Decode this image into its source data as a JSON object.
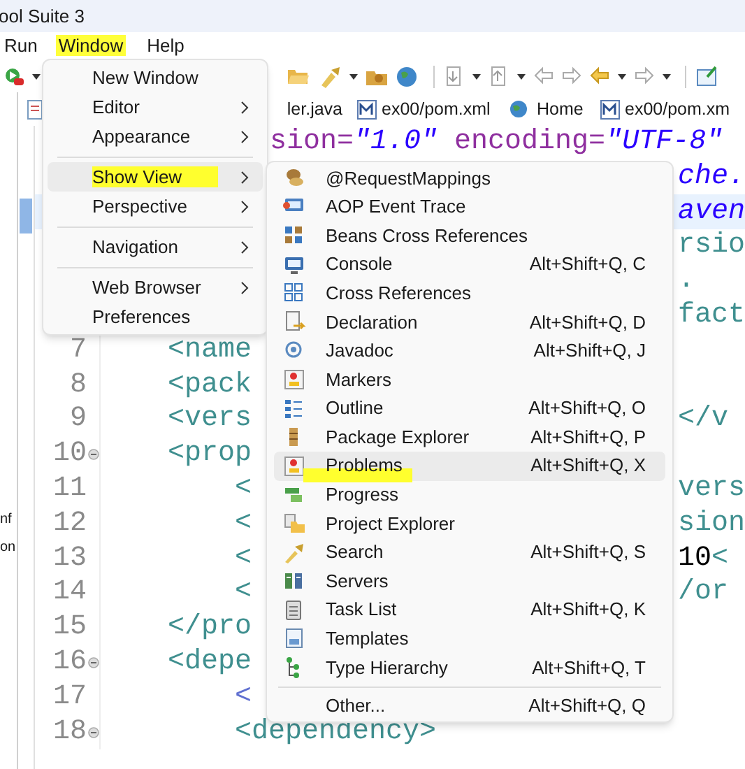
{
  "window": {
    "title": "ool Suite 3"
  },
  "menu_bar": [
    {
      "label": "Run",
      "highlighted": false
    },
    {
      "label": "Window",
      "highlighted": true
    },
    {
      "label": "Help",
      "highlighted": false
    }
  ],
  "editor_tabs": [
    {
      "label": "ler.java"
    },
    {
      "label": "ex00/pom.xml"
    },
    {
      "label": "Home"
    },
    {
      "label": "ex00/pom.xm"
    }
  ],
  "side_panel": {
    "texts": [
      "nf",
      "on"
    ]
  },
  "code_lines": [
    {
      "current": false,
      "right": {
        "kind": "near",
        "segments": [
          {
            "kind": "attr",
            "text": "sion="
          },
          {
            "kind": "string",
            "text": "\"1.0\""
          },
          {
            "kind": "attr",
            "text": " encoding="
          },
          {
            "kind": "string",
            "text": "\"UTF-8\""
          }
        ]
      }
    },
    {
      "current": false,
      "right": {
        "kind": "far",
        "segments": [
          {
            "kind": "string",
            "text": "che."
          }
        ]
      }
    },
    {
      "current": true,
      "right": {
        "kind": "far",
        "segments": [
          {
            "kind": "string",
            "text": "aven"
          }
        ]
      }
    },
    {
      "current": false,
      "right": {
        "kind": "far",
        "segments": [
          {
            "kind": "tag",
            "text": "rsio"
          }
        ]
      }
    },
    {
      "current": false,
      "right": {
        "kind": "far",
        "segments": [
          {
            "kind": "tag",
            "text": "."
          }
        ]
      }
    },
    {
      "current": false,
      "right": {
        "kind": "far",
        "segments": [
          {
            "kind": "tag",
            "text": "fact"
          }
        ]
      }
    },
    {
      "number": "7",
      "fold": false,
      "current": false,
      "left": [
        {
          "kind": "tag",
          "text": "<name"
        }
      ]
    },
    {
      "number": "8",
      "fold": false,
      "current": false,
      "left": [
        {
          "kind": "tag",
          "text": "<pack"
        }
      ]
    },
    {
      "number": "9",
      "fold": false,
      "current": false,
      "left": [
        {
          "kind": "tag",
          "text": "<vers"
        }
      ],
      "right": {
        "kind": "far",
        "segments": [
          {
            "kind": "tag",
            "text": "</v"
          }
        ]
      }
    },
    {
      "number": "10",
      "fold": true,
      "current": false,
      "left": [
        {
          "kind": "tag",
          "text": "<prop"
        }
      ],
      "children": [
        {
          "number": "11",
          "fold": false,
          "current": false,
          "left": [
            {
              "kind": "tag",
              "text": "<"
            }
          ],
          "right": {
            "kind": "far",
            "segments": [
              {
                "kind": "tag",
                "text": "vers"
              }
            ]
          }
        },
        {
          "number": "12",
          "fold": false,
          "current": false,
          "left": [
            {
              "kind": "tag",
              "text": "<"
            }
          ],
          "right": {
            "kind": "far",
            "segments": [
              {
                "kind": "tag",
                "text": "sion"
              }
            ]
          }
        },
        {
          "number": "13",
          "fold": false,
          "current": false,
          "left": [
            {
              "kind": "tag",
              "text": "<"
            }
          ],
          "right": {
            "kind": "far",
            "segments": [
              {
                "kind": "text",
                "text": "10"
              },
              {
                "kind": "tag",
                "text": "<"
              }
            ]
          }
        },
        {
          "number": "14",
          "fold": false,
          "current": false,
          "left": [
            {
              "kind": "tag",
              "text": "<"
            }
          ],
          "right": {
            "kind": "far",
            "segments": [
              {
                "kind": "tag",
                "text": "/or"
              }
            ]
          }
        }
      ]
    },
    {
      "number": "15",
      "fold": false,
      "current": false,
      "left": [
        {
          "kind": "tag",
          "text": "</pro"
        }
      ]
    },
    {
      "number": "16",
      "fold": true,
      "current": false,
      "left": [
        {
          "kind": "tag",
          "text": "<depe"
        }
      ],
      "children": [
        {
          "number": "17",
          "fold": false,
          "current": false,
          "left": [
            {
              "kind": "comment",
              "text": "<"
            }
          ]
        },
        {
          "number": "18",
          "fold": true,
          "current": false,
          "left": [
            {
              "kind": "tag",
              "text": "<dependency>"
            }
          ]
        }
      ]
    }
  ],
  "window_menu": {
    "groups": [
      [
        {
          "label": "New Window",
          "submenu": false,
          "selected": false,
          "highlighted": false
        },
        {
          "label": "Editor",
          "submenu": true,
          "selected": false,
          "highlighted": false
        },
        {
          "label": "Appearance",
          "submenu": true,
          "selected": false,
          "highlighted": false
        }
      ],
      [
        {
          "label": "Show View",
          "submenu": true,
          "selected": true,
          "highlighted": true
        },
        {
          "label": "Perspective",
          "submenu": true,
          "selected": false,
          "highlighted": false
        }
      ],
      [
        {
          "label": "Navigation",
          "submenu": true,
          "selected": false,
          "highlighted": false
        }
      ],
      [
        {
          "label": "Web Browser",
          "submenu": true,
          "selected": false,
          "highlighted": false
        },
        {
          "label": "Preferences",
          "submenu": false,
          "selected": false,
          "highlighted": false
        }
      ]
    ]
  },
  "show_view_menu": {
    "groups": [
      [
        {
          "label": "@RequestMappings",
          "selected": false,
          "highlighted": false
        },
        {
          "label": "AOP Event Trace",
          "selected": false,
          "highlighted": false
        },
        {
          "label": "Beans Cross References",
          "selected": false,
          "highlighted": false
        },
        {
          "label": "Console",
          "shortcut": "Alt+Shift+Q, C",
          "selected": false,
          "highlighted": false
        },
        {
          "label": "Cross References",
          "selected": false,
          "highlighted": false
        },
        {
          "label": "Declaration",
          "shortcut": "Alt+Shift+Q, D",
          "selected": false,
          "highlighted": false
        },
        {
          "label": "Javadoc",
          "shortcut": "Alt+Shift+Q, J",
          "selected": false,
          "highlighted": false
        },
        {
          "label": "Markers",
          "selected": false,
          "highlighted": false
        },
        {
          "label": "Outline",
          "shortcut": "Alt+Shift+Q, O",
          "selected": false,
          "highlighted": false
        },
        {
          "label": "Package Explorer",
          "shortcut": "Alt+Shift+Q, P",
          "selected": false,
          "highlighted": false
        },
        {
          "label": "Problems",
          "shortcut": "Alt+Shift+Q, X",
          "selected": true,
          "highlighted": true
        },
        {
          "label": "Progress",
          "selected": false,
          "highlighted": false
        },
        {
          "label": "Project Explorer",
          "selected": false,
          "highlighted": false
        },
        {
          "label": "Search",
          "shortcut": "Alt+Shift+Q, S",
          "selected": false,
          "highlighted": false
        },
        {
          "label": "Servers",
          "selected": false,
          "highlighted": false
        },
        {
          "label": "Task List",
          "shortcut": "Alt+Shift+Q, K",
          "selected": false,
          "highlighted": false
        },
        {
          "label": "Templates",
          "selected": false,
          "highlighted": false
        },
        {
          "label": "Type Hierarchy",
          "shortcut": "Alt+Shift+Q, T",
          "selected": false,
          "highlighted": false
        }
      ],
      [
        {
          "label": "Other...",
          "shortcut": "Alt+Shift+Q, Q",
          "selected": false,
          "highlighted": false
        }
      ]
    ]
  }
}
